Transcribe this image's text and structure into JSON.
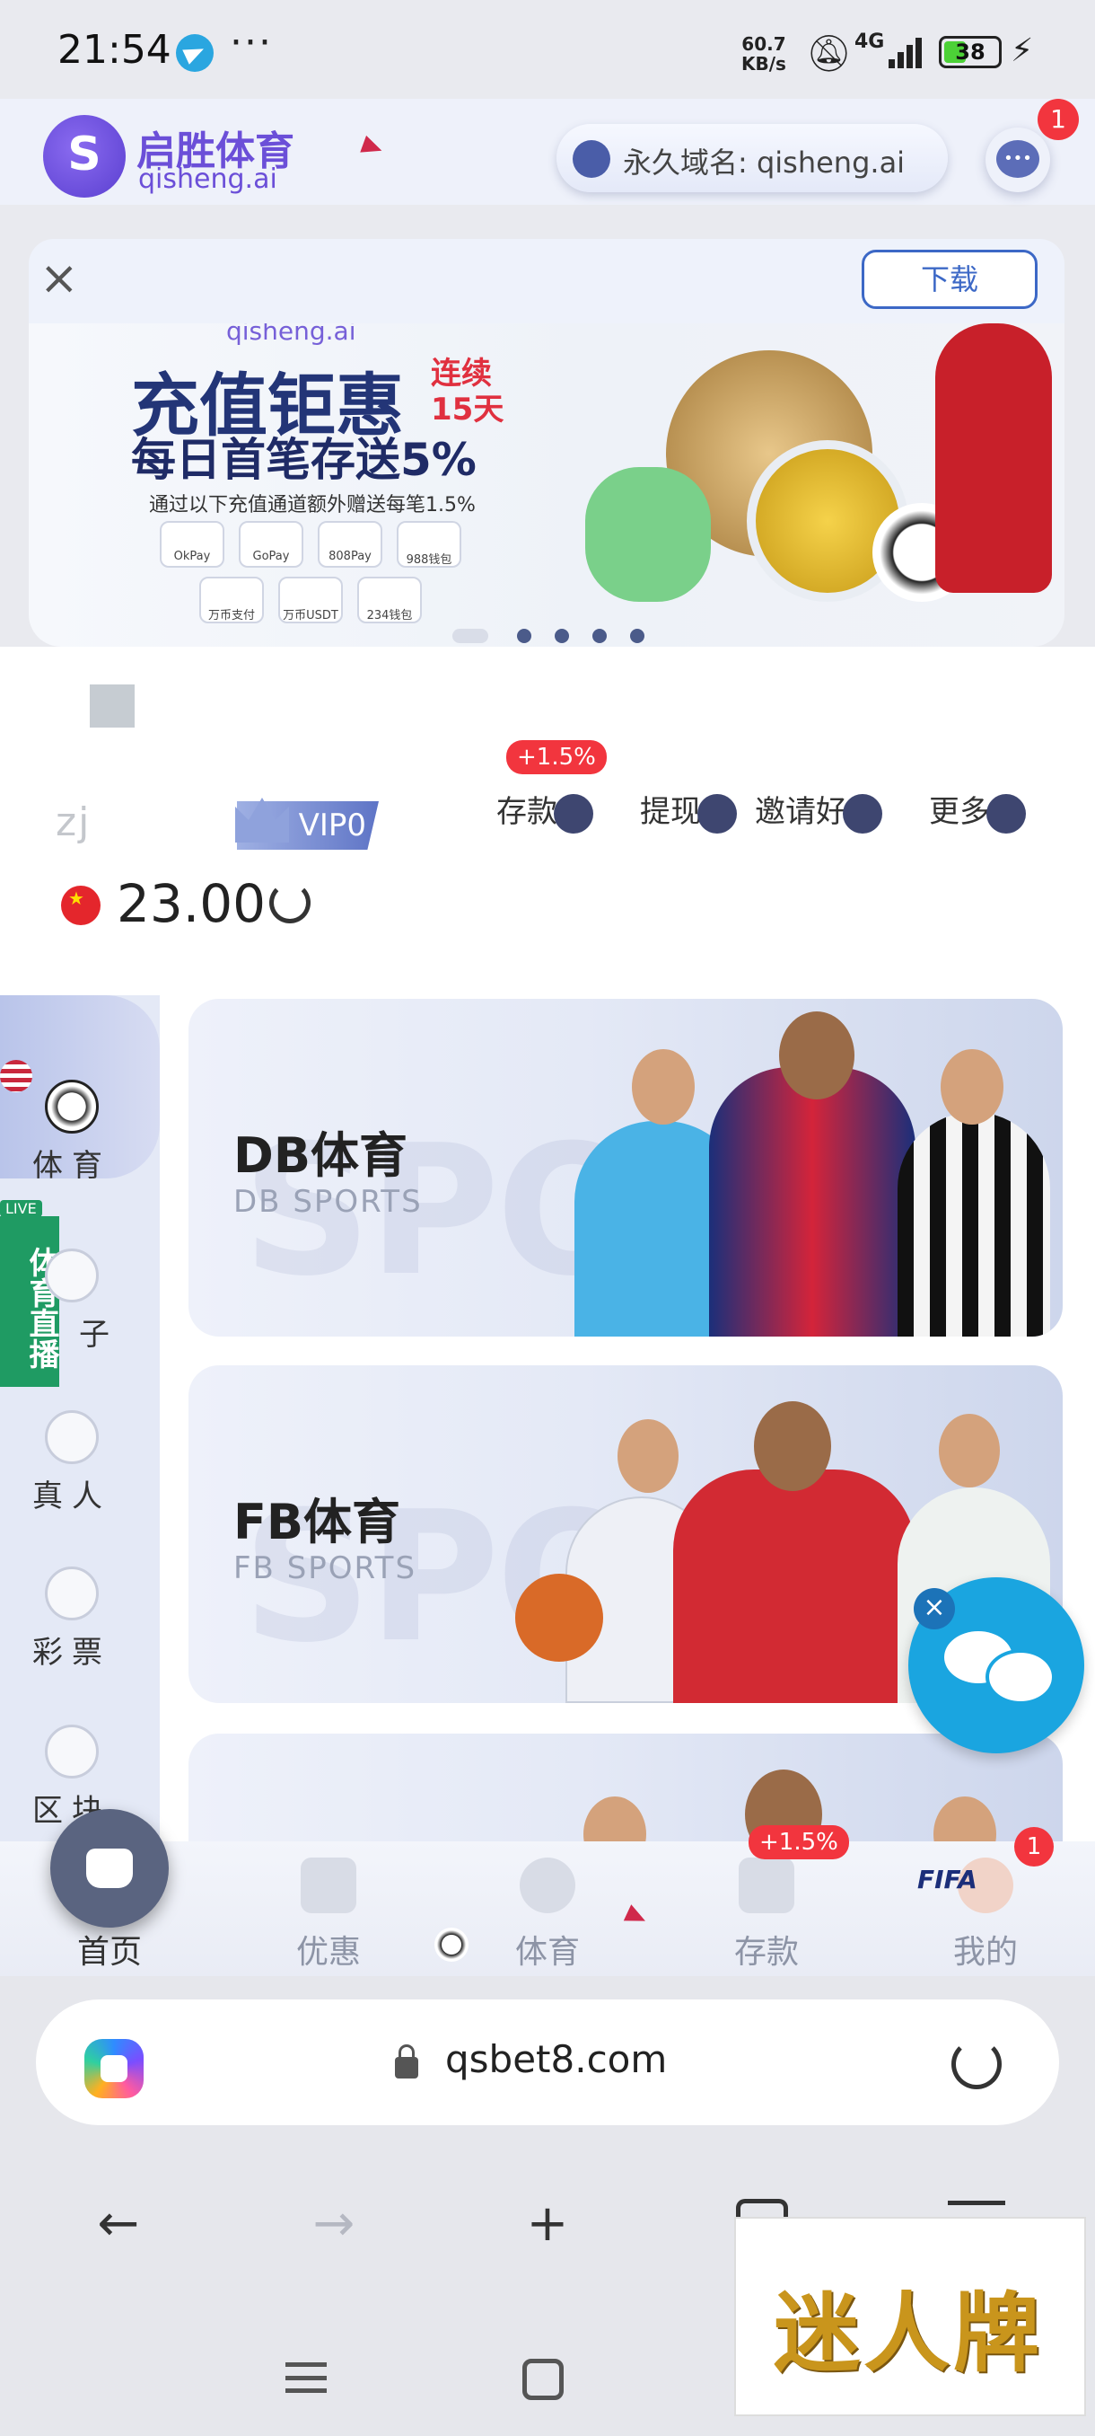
{
  "status_bar": {
    "time": "21:54",
    "more": "···",
    "net_speed_value": "60.7",
    "net_speed_unit": "KB/s",
    "network": "4G",
    "battery": "38",
    "icons": [
      "telegram-icon",
      "bell-muted-icon",
      "signal-icon",
      "battery-icon",
      "charging-icon"
    ]
  },
  "header": {
    "brand_cn": "启胜体育",
    "brand_en": "qisheng.ai",
    "domain_label": "永久域名: qisheng.ai",
    "chat_badge": "1"
  },
  "download_bar": {
    "close": "×",
    "download_label": "下载"
  },
  "banner": {
    "brand": "qisheng.ai",
    "title": "充值钜惠",
    "tag_line1": "连续",
    "tag_line2": "15天",
    "subtitle": "每日首笔存送5%",
    "note": "通过以下充值通道额外赠送每笔1.5%",
    "payments_row1": [
      "OkPay",
      "GoPay",
      "808Pay",
      "988钱包"
    ],
    "payments_row2": [
      "万币支付",
      "万币USDT",
      "234钱包"
    ],
    "slide_count": 5,
    "active_slide": 0
  },
  "user": {
    "username": "zj",
    "vip": "VIP0",
    "balance": "23.00",
    "actions": [
      {
        "label": "存款",
        "badge": "+1.5%",
        "icon": "wallet-icon"
      },
      {
        "label": "提现",
        "badge": "",
        "icon": "withdraw-icon"
      },
      {
        "label": "邀请好友",
        "badge": "",
        "icon": "invite-icon"
      },
      {
        "label": "更多",
        "badge": "",
        "icon": "more-grid-icon"
      }
    ]
  },
  "side_nav": {
    "items": [
      {
        "label": "体育",
        "icon": "soccer-ball-icon",
        "active": true
      },
      {
        "label": "子",
        "icon": "esports-icon",
        "active": false
      },
      {
        "label": "真人",
        "icon": "live-casino-icon",
        "active": false
      },
      {
        "label": "彩票",
        "icon": "lottery-icon",
        "active": false
      },
      {
        "label": "区块",
        "icon": "blockchain-icon",
        "active": false
      }
    ],
    "live_label": "体育直播",
    "live_mini": "LIVE"
  },
  "cards": [
    {
      "title": "DB体育",
      "subtitle": "DB SPORTS",
      "bg_text": "SPORTS"
    },
    {
      "title": "FB体育",
      "subtitle": "FB SPORTS",
      "bg_text": "SPORTS"
    }
  ],
  "float_chat": {
    "close": "×"
  },
  "tabbar": {
    "tabs": [
      {
        "label": "首页",
        "icon": "home-icon",
        "active": true
      },
      {
        "label": "优惠",
        "icon": "gift-icon",
        "active": false
      },
      {
        "label": "体育",
        "icon": "soccer-ball-icon",
        "active": false
      },
      {
        "label": "存款",
        "icon": "wallet-icon",
        "active": false
      },
      {
        "label": "我的",
        "icon": "profile-icon",
        "active": false
      }
    ],
    "deposit_badge": "+1.5%",
    "me_badge": "1",
    "fifa": "FIFA"
  },
  "browser": {
    "url": "qsbet8.com"
  },
  "toolbar": {
    "back": "←",
    "forward": "→",
    "new_tab": "+"
  },
  "watermark": {
    "text": "迷人牌"
  },
  "colors": {
    "accent": "#6b4fd8",
    "link_blue": "#3c68c6",
    "badge_red": "#f2353e",
    "live_green": "#1f9b63",
    "chat_blue": "#1aa5e0"
  }
}
